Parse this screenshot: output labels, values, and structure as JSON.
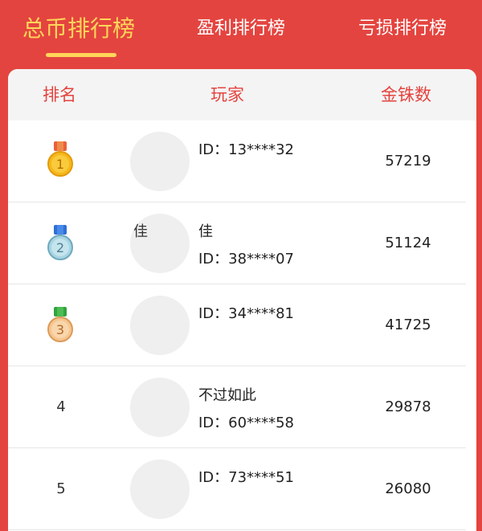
{
  "tabs": [
    {
      "label": "总币排行榜",
      "active": true
    },
    {
      "label": "盈利排行榜",
      "active": false
    },
    {
      "label": "亏损排行榜",
      "active": false
    }
  ],
  "colors": {
    "accent": "#e4443f",
    "highlight": "#ffd65a"
  },
  "table": {
    "headers": {
      "rank": "排名",
      "player": "玩家",
      "coins": "金铢数"
    },
    "rows": [
      {
        "rank": "1",
        "medal": "gold-medal-icon",
        "nickname": "",
        "avatar_alt": "",
        "id": "ID：13****32",
        "coins": "57219"
      },
      {
        "rank": "2",
        "medal": "silver-medal-icon",
        "nickname": "佳",
        "avatar_alt": "佳",
        "id": "ID：38****07",
        "coins": "51124"
      },
      {
        "rank": "3",
        "medal": "bronze-medal-icon",
        "nickname": "",
        "avatar_alt": "",
        "id": "ID：34****81",
        "coins": "41725"
      },
      {
        "rank": "4",
        "medal": "",
        "nickname": "不过如此",
        "avatar_alt": "",
        "id": "ID：60****58",
        "coins": "29878"
      },
      {
        "rank": "5",
        "medal": "",
        "nickname": "",
        "avatar_alt": "",
        "id": "ID：73****51",
        "coins": "26080"
      }
    ]
  }
}
